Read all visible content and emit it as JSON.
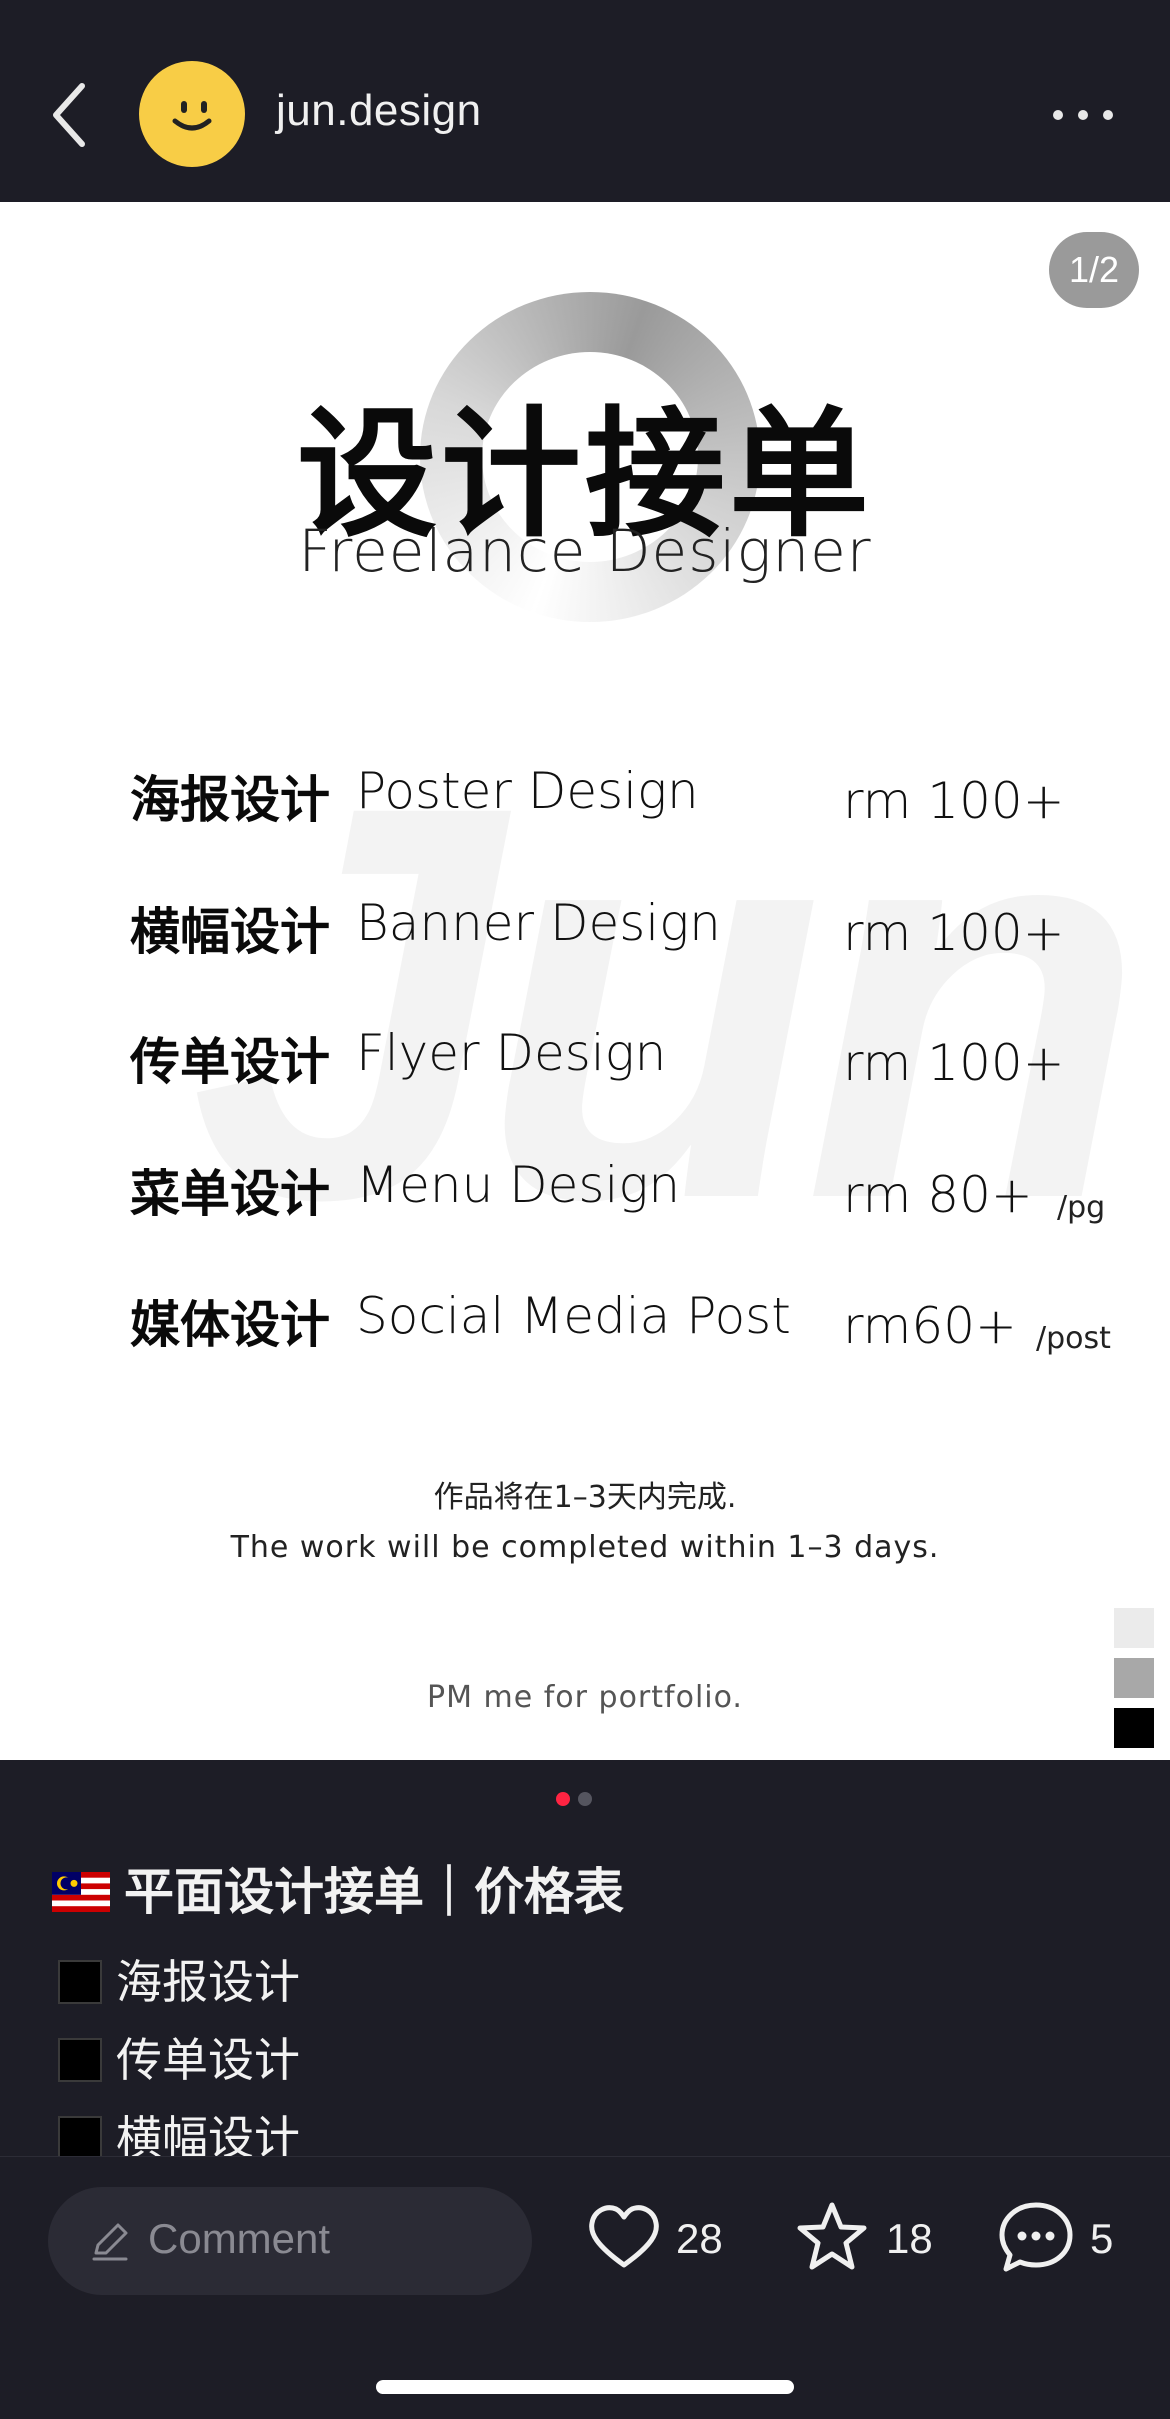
{
  "header": {
    "username": "jun.design",
    "avatar_color": "#f8cd46"
  },
  "poster": {
    "page_counter": "1/2",
    "title": "设计接单",
    "subtitle": "Freelance Designer",
    "watermark": "Jun",
    "services": [
      {
        "cn": "海报设计",
        "en": "Poster Design",
        "price": "rm 100+",
        "unit": ""
      },
      {
        "cn": "横幅设计",
        "en": "Banner Design",
        "price": "rm 100+",
        "unit": ""
      },
      {
        "cn": "传单设计",
        "en": "Flyer Design",
        "price": "rm 100+",
        "unit": ""
      },
      {
        "cn": "菜单设计",
        "en": "Menu Design",
        "price": "rm 80+",
        "unit": "/pg"
      },
      {
        "cn": "媒体设计",
        "en": "Social Media Post",
        "price": "rm60+",
        "unit": "/post"
      }
    ],
    "note_cn": "作品将在1–3天内完成.",
    "note_en": "The work will be completed within 1–3 days.",
    "portfolio_note": "PM me for portfolio.",
    "swatches": [
      "#ebebeb",
      "#a8a8a8",
      "#000000"
    ]
  },
  "carousel": {
    "active_color": "#ff2442",
    "inactive_color": "#55555f"
  },
  "post": {
    "flag_icon": "malaysia-flag-icon",
    "title": "平面设计接单｜价格表",
    "checklist": [
      "海报设计",
      "传单设计",
      "横幅设计"
    ]
  },
  "bottom_bar": {
    "comment_placeholder": "Comment",
    "likes": "28",
    "favorites": "18",
    "comments": "5"
  }
}
